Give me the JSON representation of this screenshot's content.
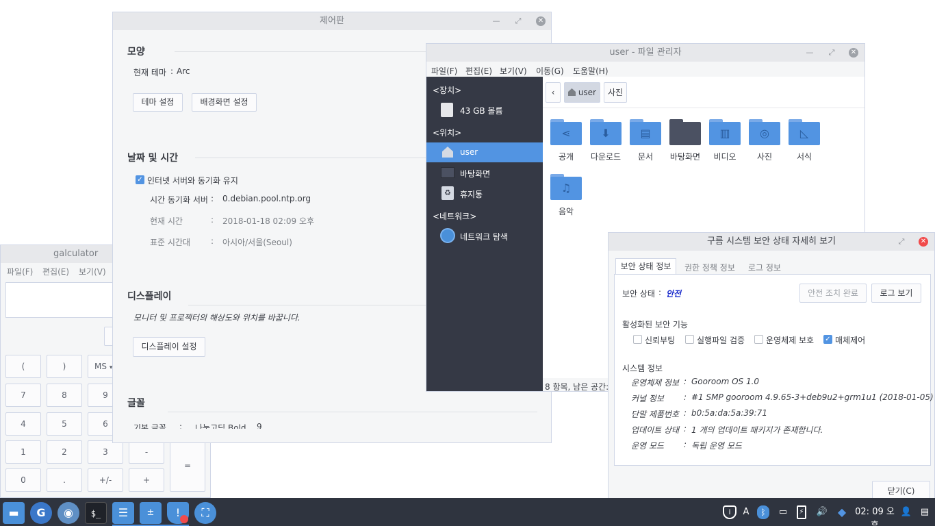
{
  "calculator": {
    "title": "galculator",
    "menu": [
      "파일(F)",
      "편집(E)",
      "보기(V)"
    ],
    "keys": [
      "(",
      ")",
      "MS",
      "7",
      "8",
      "9",
      "4",
      "5",
      "6",
      "1",
      "2",
      "3",
      "-",
      "0",
      ".",
      "+/-",
      "+",
      "="
    ]
  },
  "control_panel": {
    "title": "제어판",
    "appearance": {
      "heading": "모양",
      "theme_label": "현재 테마",
      "theme_sep": ":",
      "theme_value": "Arc",
      "theme_button": "테마 설정",
      "wallpaper_button": "배경화면 설정"
    },
    "datetime": {
      "heading": "날짜 및 시간",
      "sync_checkbox": "인터넷 서버와 동기화 유지",
      "rows": [
        {
          "label": "시간 동기화 서버",
          "sep": ":",
          "value": "0.debian.pool.ntp.org"
        },
        {
          "label": "현재 시간",
          "sep": ":",
          "value": "2018-01-18 02:09 오후"
        },
        {
          "label": "표준 시간대",
          "sep": ":",
          "value": "아시아/서울(Seoul)"
        }
      ]
    },
    "display": {
      "heading": "디스플레이",
      "description": "모니터 및 프로젝터의 해상도와 위치를 바꿉니다.",
      "button": "디스플레이 설정"
    },
    "font": {
      "heading": "글꼴",
      "label": "기본 글꼴",
      "sep": ":",
      "value": "나눔고딕 Bold",
      "size": "9"
    }
  },
  "file_manager": {
    "title": "user - 파일 관리자",
    "menu": [
      "파일(F)",
      "편집(E)",
      "보기(V)",
      "이동(G)",
      "도움말(H)"
    ],
    "sidebar": {
      "devices_heading": "<장치>",
      "volume": "43 GB 볼륨",
      "places_heading": "<위치>",
      "home": "user",
      "desktop": "바탕화면",
      "trash": "휴지통",
      "network_heading": "<네트워크>",
      "network_browse": "네트워크 탐색"
    },
    "path": {
      "home": "user",
      "current": "사진"
    },
    "folders": [
      "공개",
      "다운로드",
      "문서",
      "바탕화면",
      "비디오",
      "사진",
      "서식",
      "음악"
    ],
    "folder_icons": [
      "share-icon",
      "download-icon",
      "document-icon",
      "desktop-icon",
      "video-icon",
      "camera-icon",
      "template-icon",
      "music-icon"
    ],
    "status": "8 항목, 남은 공간:"
  },
  "security_dialog": {
    "title": "구름 시스템 보안 상태 자세히 보기",
    "tabs": [
      "보안 상태 정보",
      "권한 정책 정보",
      "로그 정보"
    ],
    "status_label": "보안 상태",
    "status_sep": ":",
    "status_value": "안전",
    "status_color": "#1a2bcc",
    "done_button": "안전 조치 완료",
    "log_button": "로그 보기",
    "features_heading": "활성화된 보안 기능",
    "features": [
      {
        "label": "신뢰부팅",
        "checked": false
      },
      {
        "label": "실행파일 검증",
        "checked": false
      },
      {
        "label": "운영체제 보호",
        "checked": false
      },
      {
        "label": "매체제어",
        "checked": true
      }
    ],
    "sysinfo_heading": "시스템 정보",
    "sysinfo": [
      {
        "label": "운영체제 정보",
        "sep": ":",
        "value": "Gooroom OS 1.0"
      },
      {
        "label": "커널 정보",
        "sep": ":",
        "value": "#1 SMP gooroom 4.9.65-3+deb9u2+grm1u1 (2018-01-05)"
      },
      {
        "label": "단말 제품번호",
        "sep": ":",
        "value": "b0:5a:da:5a:39:71"
      },
      {
        "label": "업데이트 상태",
        "sep": ":",
        "value": "1 개의 업데이트 패키지가 존재합니다."
      },
      {
        "label": "운영 모드",
        "sep": ":",
        "value": "독립 운영 모드"
      }
    ],
    "close_button": "닫기(C)"
  },
  "taskbar": {
    "clock": "02: 09 오후",
    "keyboard_indicator": "A",
    "accent": "#2f343f"
  }
}
